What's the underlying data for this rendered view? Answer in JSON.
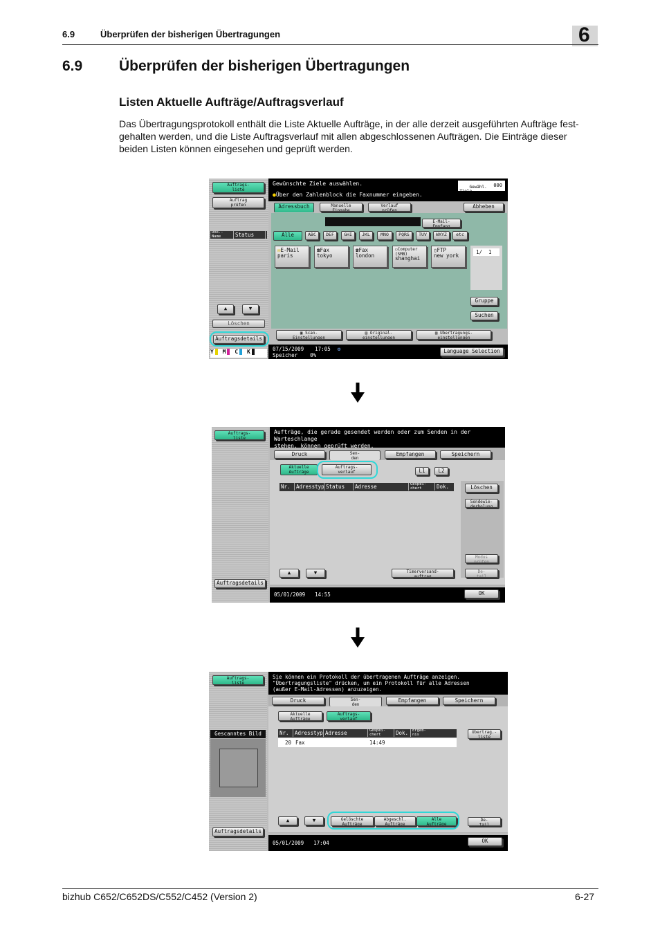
{
  "header": {
    "section_number": "6.9",
    "section_title": "Überprüfen der bisherigen Übertragungen",
    "chapter": "6"
  },
  "heading": {
    "number": "6.9",
    "title": "Überprüfen der bisherigen Übertragungen"
  },
  "subheading": "Listen Aktuelle Aufträge/Auftragsverlauf",
  "intro_lines": [
    "Das Übertragungsprotokoll enthält die Liste Aktuelle Aufträge, in der alle derzeit ausgeführten Aufträge fest-",
    "gehalten werden, und die Liste Auftragsverlauf mit allen abgeschlossenen Aufträgen. Die Einträge dieser",
    "beiden Listen können eingesehen und geprüft werden."
  ],
  "screen1": {
    "side_btn_job_list": "Auftrags-\nliste",
    "side_btn_job_check": "Auftrag\nprüfen",
    "side_col_name": "Dok.-\nName",
    "side_col_status": "Status",
    "side_btn_delete": "Löschen",
    "side_btn_details": "Auftragsdetails",
    "msg_line1": "Gewünschte Ziele auswählen.",
    "msg_line2": "Über den Zahlenblock die Faxnummer eingeben.",
    "counter_label": "Gewähl.\nZiele",
    "counter_value": "000",
    "tab_addressbook": "Adressbuch",
    "tab_manual": "Manuelle\nEingabe",
    "tab_history": "Verlauf\nprüfen",
    "btn_pickup": "Abheben",
    "btn_email_receive": "E-Mail-\nEmpfang",
    "index_tabs": [
      "Alle",
      "ABC",
      "DEF",
      "GHI",
      "JKL",
      "MNO",
      "PQRS",
      "TUV",
      "WXYZ",
      "etc"
    ],
    "destinations": [
      {
        "type": "E-Mail",
        "name": "paris"
      },
      {
        "type": "Fax",
        "name": "tokyo"
      },
      {
        "type": "Fax",
        "name": "london"
      },
      {
        "type": "Computer\n(SMB)",
        "name": "shanghai"
      },
      {
        "type": "FTP",
        "name": "new york"
      }
    ],
    "page_indicator": "1/  1",
    "btn_group": "Gruppe",
    "btn_search": "Suchen",
    "btn_scan_settings": "Scan-\nEinstellungen",
    "btn_original_settings": "Original-\neinstellungen",
    "btn_comm_settings": "Übertragungs-\neinstellungen",
    "date": "07/15/2009",
    "time": "17:05",
    "memory_label": "Speicher",
    "memory_value": "0%",
    "btn_language": "Language Selection",
    "toner_labels": [
      "Y",
      "M",
      "C",
      "K"
    ],
    "toner_colors": [
      "#e6d200",
      "#d0209a",
      "#20a0d8",
      "#111111"
    ]
  },
  "screen2": {
    "side_btn_job_list": "Auftrags-\nliste",
    "side_btn_details": "Auftragsdetails",
    "msg_line1": "Aufträge, die gerade gesendet werden oder zum Senden in der Warteschlange",
    "msg_line2": "stehen, können geprüft werden.",
    "tabs": [
      "Druck",
      "Sen-\nden",
      "Empfangen",
      "Speichern"
    ],
    "btn_current_jobs": "Aktuelle\nAufträge",
    "btn_job_history": "Auftrags-\nverlauf",
    "btn_l1": "L1",
    "btn_l2": "L2",
    "columns": [
      "Nr.",
      "Adresstyp",
      "Status",
      "Adresse",
      "Gespei-\nchert",
      "Dok."
    ],
    "btn_delete": "Löschen",
    "btn_retry": "Sendewie-\nderholung",
    "btn_check_mode": "Modus\nprüfen",
    "btn_detail": "De-\ntail",
    "btn_timer": "Timerversand-\nauftrag",
    "date": "05/01/2009",
    "time": "14:55",
    "btn_ok": "OK"
  },
  "screen3": {
    "side_btn_job_list": "Auftrags-\nliste",
    "side_label_scanned": "Gescanntes Bild",
    "side_btn_details": "Auftragsdetails",
    "msg_line1": "Sie können ein Protokoll der übertragenen Aufträge anzeigen.",
    "msg_line2": "\"Übertragungsliste\" drücken, um ein Protokoll für alle Adressen",
    "msg_line3": "(außer E-Mail-Adressen) anzuzeigen.",
    "tabs": [
      "Druck",
      "Sen-\nden",
      "Empfangen",
      "Speichern"
    ],
    "btn_current_jobs": "Aktuelle\nAufträge",
    "btn_job_history": "Auftrags-\nverlauf",
    "columns": [
      "Nr.",
      "Adresstyp",
      "Adresse",
      "Gespei-\nchert",
      "Dok.",
      "Ergeb-\nnis"
    ],
    "row": {
      "nr": "20",
      "type": "Fax",
      "time": "14:49"
    },
    "btn_transmission_list": "Übertrag.-\nliste",
    "btn_deleted_jobs": "Gelöschte\nAufträge",
    "btn_finished_jobs": "Abgeschl.\nAufträge",
    "btn_all_jobs": "Alle\nAufträge",
    "btn_detail": "De-\ntail",
    "date": "05/01/2009",
    "time": "17:04",
    "btn_ok": "OK"
  },
  "footer": {
    "product": "bizhub C652/C652DS/C552/C452 (Version 2)",
    "page": "6-27"
  }
}
